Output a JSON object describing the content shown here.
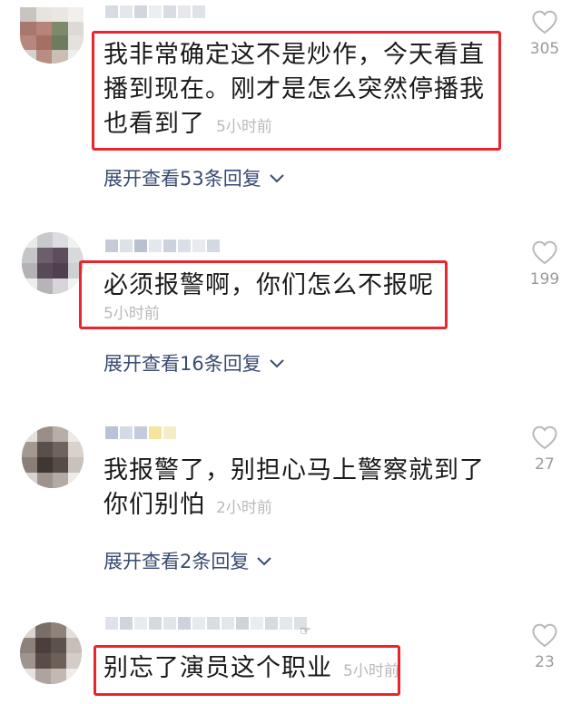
{
  "comments": [
    {
      "lines": [
        "我非常确定这不是炒作，今天看直",
        "播到现在。刚才是怎么突然停播我",
        "也看到了"
      ],
      "time": "5小时前",
      "likes": "305",
      "expand": "展开查看53条回复"
    },
    {
      "lines": [
        "必须报警啊，你们怎么不报呢"
      ],
      "time": "5小时前",
      "likes": "199",
      "expand": "展开查看16条回复"
    },
    {
      "lines": [
        "我报警了，别担心马上警察就到了",
        "你们别怕"
      ],
      "time": "2小时前",
      "likes": "27",
      "expand": "展开查看2条回复"
    },
    {
      "lines": [
        "别忘了演员这个职业"
      ],
      "time": "5小时前",
      "likes": "23"
    }
  ],
  "icons": {
    "like": "heart-outline-icon",
    "expand": "chevron-down-icon",
    "cursor": "pointing-hand-icon"
  },
  "colors": {
    "highlight_box": "#e8262b",
    "link": "#394a70",
    "muted": "#b9b9b9"
  }
}
